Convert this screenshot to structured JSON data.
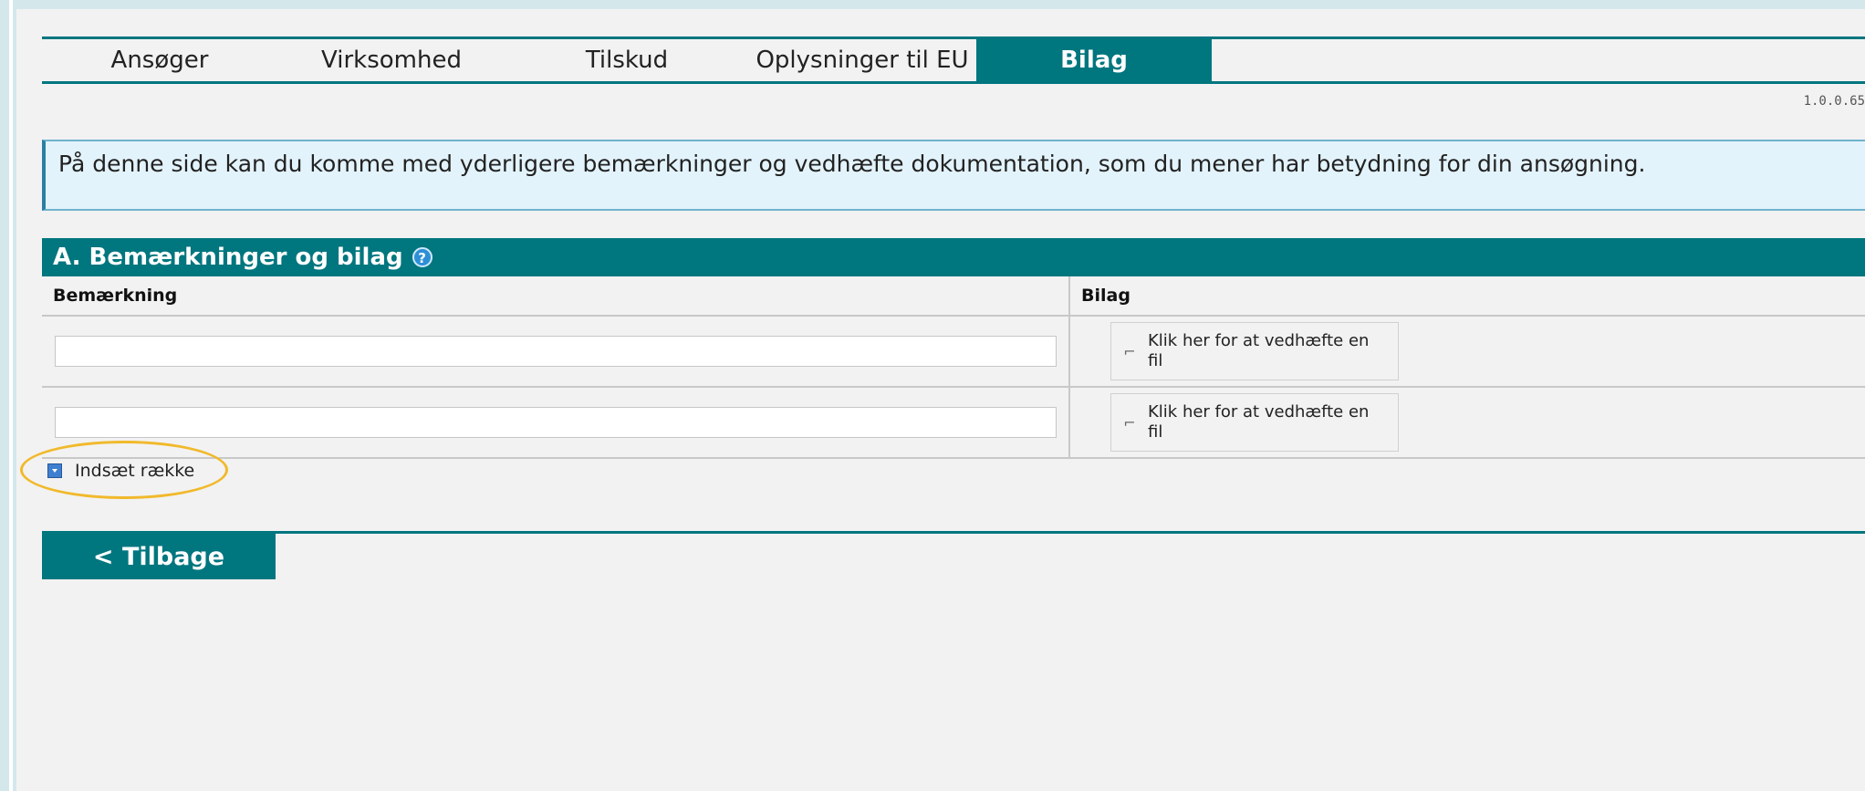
{
  "tabs": [
    {
      "label": "Ansøger",
      "active": false
    },
    {
      "label": "Virksomhed",
      "active": false
    },
    {
      "label": "Tilskud",
      "active": false
    },
    {
      "label": "Oplysninger til EU",
      "active": false
    },
    {
      "label": "Bilag",
      "active": true
    }
  ],
  "version": "1.0.0.65",
  "info_text": "På denne side kan du komme med yderligere bemærkninger og vedhæfte dokumentation, som du mener har betydning for din ansøgning.",
  "section": {
    "title": "A. Bemærkninger og bilag",
    "help_icon_glyph": "?",
    "columns": {
      "remark": "Bemærkning",
      "attachment": "Bilag"
    },
    "rows": [
      {
        "remark_value": "",
        "attach_label": "Klik her for at vedhæfte en fil"
      },
      {
        "remark_value": "",
        "attach_label": "Klik her for at vedhæfte en fil"
      }
    ],
    "insert_row_label": "Indsæt række"
  },
  "back_label": "< Tilbage",
  "colors": {
    "accent": "#00767f",
    "highlight": "#f1b92b",
    "info_bg": "#e3f3fb"
  },
  "icons": {
    "help": "help-icon",
    "attach": "paperclip-icon",
    "add": "add-row-icon"
  }
}
